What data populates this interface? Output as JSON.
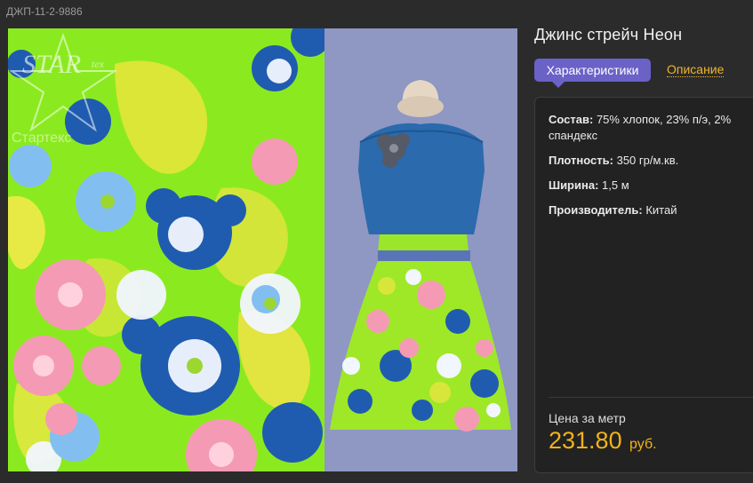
{
  "product": {
    "sku": "ДЖП-11-2-9886",
    "title": "Джинс стрейч Неон"
  },
  "tabs": {
    "active_label": "Характеристики",
    "link_label": "Описание"
  },
  "specs": [
    {
      "key": "Состав:",
      "value": "75% хлопок, 23% п/э, 2% спандекс"
    },
    {
      "key": "Плотность:",
      "value": "350 гр/м.кв."
    },
    {
      "key": "Ширина:",
      "value": "1,5 м"
    },
    {
      "key": "Производитель:",
      "value": "Китай"
    }
  ],
  "price": {
    "label": "Цена за метр",
    "value": "231.80",
    "currency": "руб."
  },
  "watermark": {
    "logo_text": "STARtex",
    "caption": "Стартекс"
  },
  "colors": {
    "accent_tab": "#6a62c7",
    "link": "#f0b429",
    "price": "#f2b21b",
    "fabric_base": "#8bea1f",
    "dress_bg": "#8f97c3"
  },
  "images": {
    "fabric_icon": "floral-fabric-image",
    "dress_icon": "dress-mannequin-image"
  }
}
